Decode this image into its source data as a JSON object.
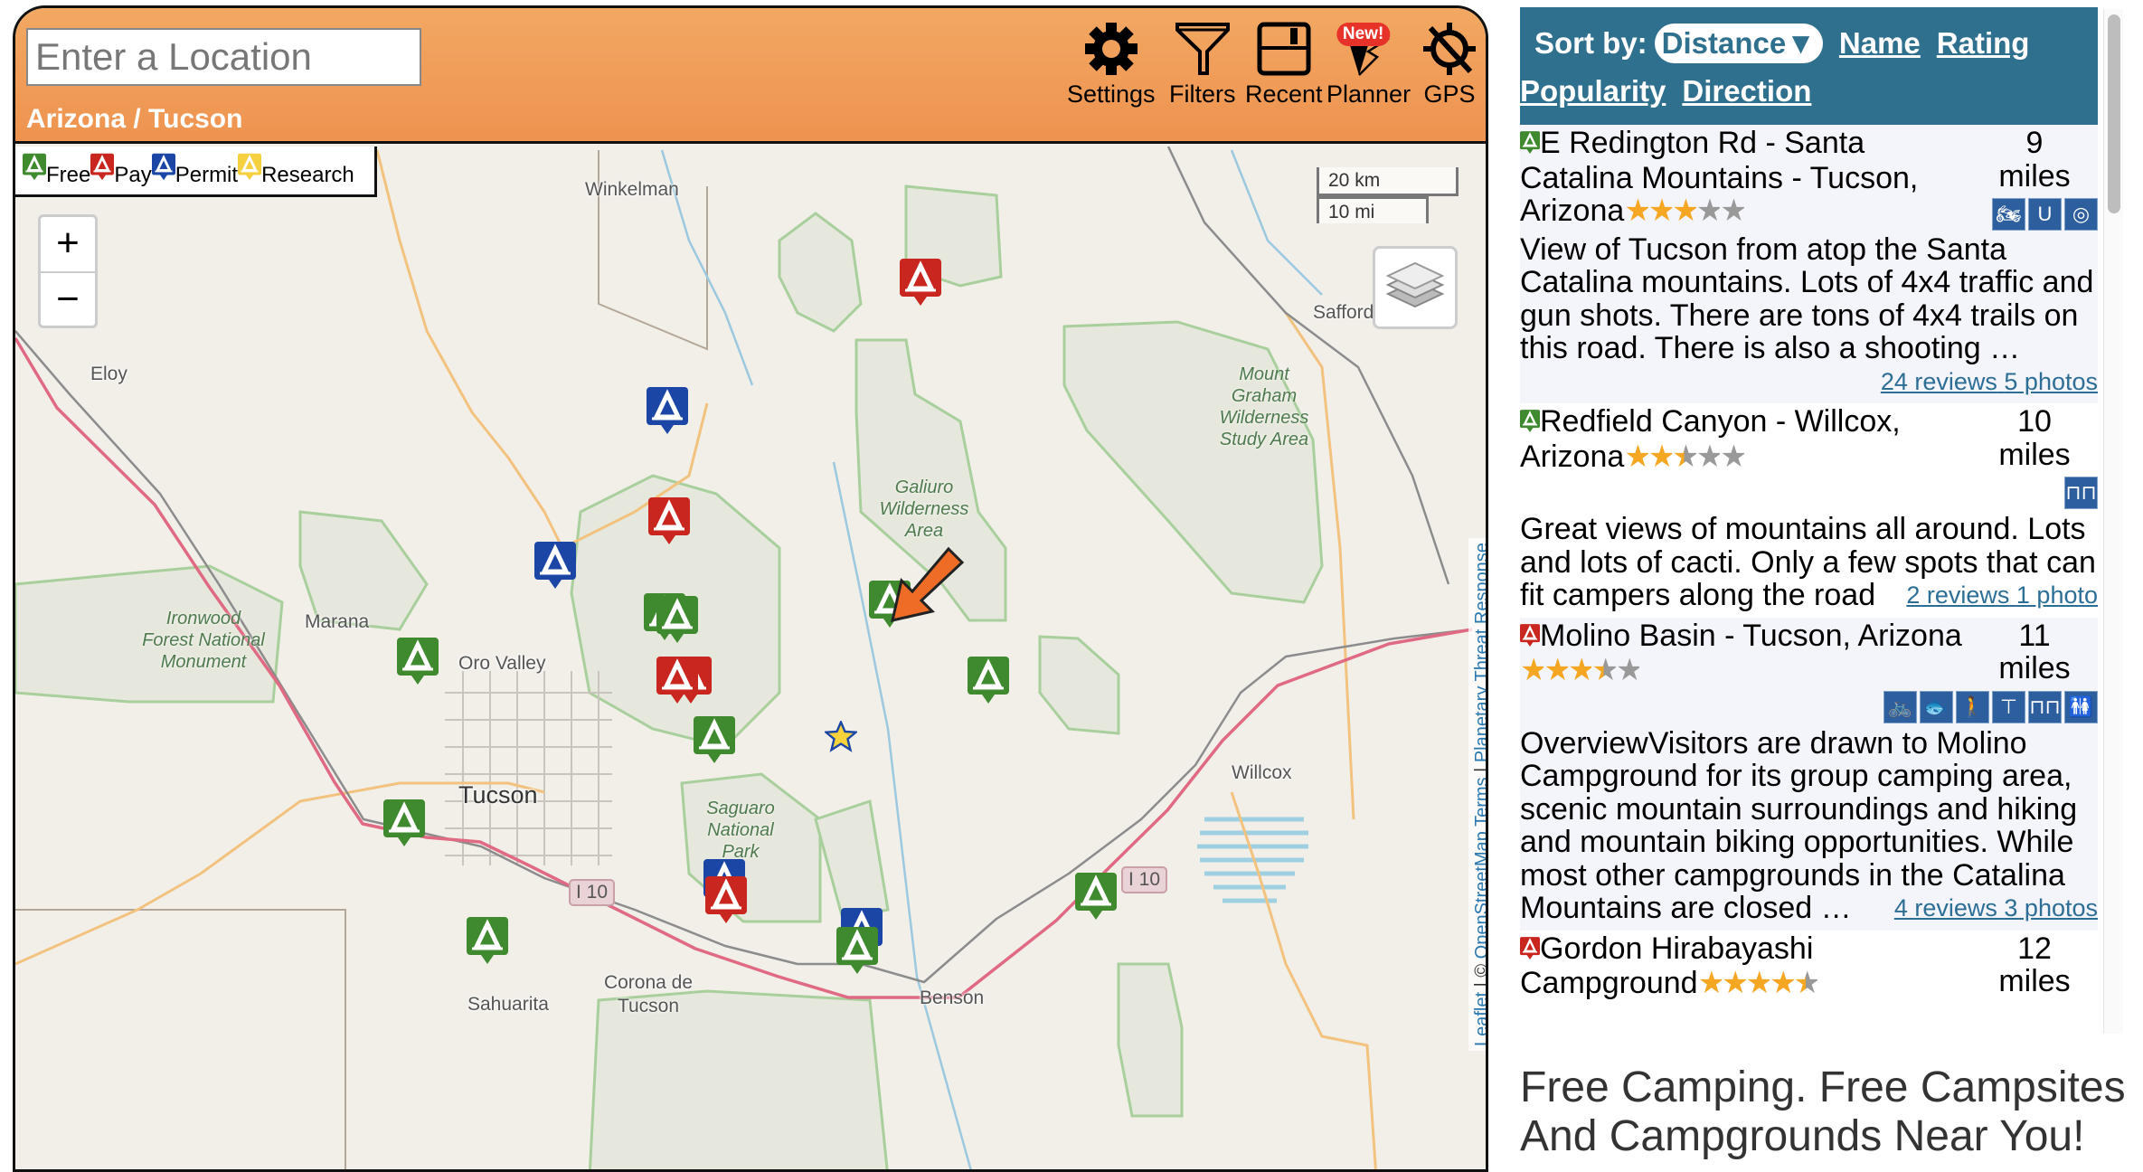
{
  "header": {
    "search_placeholder": "Enter a Location",
    "breadcrumb": "Arizona / Tucson",
    "toolbar": [
      {
        "label": "Settings",
        "icon": "gear-icon"
      },
      {
        "label": "Filters",
        "icon": "funnel-icon"
      },
      {
        "label": "Recent",
        "icon": "floppy-disk-icon"
      },
      {
        "label": "Planner",
        "icon": "map-pin-route-icon",
        "badge": "New!"
      },
      {
        "label": "GPS",
        "icon": "gps-off-icon"
      }
    ]
  },
  "legend": [
    {
      "label": "Free",
      "color": "#3f8a2f"
    },
    {
      "label": "Pay",
      "color": "#c8261e"
    },
    {
      "label": "Permit",
      "color": "#1c46a6"
    },
    {
      "label": "Research",
      "color": "#f5d142"
    }
  ],
  "map": {
    "zoom_in": "+",
    "zoom_out": "−",
    "scale_km": "20 km",
    "scale_mi": "10 mi",
    "attribution": {
      "leaflet": "Leaflet",
      "sep1": " | © ",
      "osm": "OpenStreetMap",
      "terms": " Terms",
      "sep2": " | ",
      "ptr": "Planetary Threat Response"
    },
    "places": [
      "Winkelman",
      "Eloy",
      "Safford",
      "Marana",
      "Oro Valley",
      "Tucson",
      "Willcox",
      "Benson",
      "Sahuarita",
      "Corona de Tucson"
    ],
    "parks": [
      "Mount Graham Wilderness Study Area",
      "Galiuro Wilderness Area",
      "Ironwood Forest National Monument",
      "Saguaro National Park"
    ],
    "highway": "I 10"
  },
  "sort": {
    "label": "Sort by:",
    "active": "Distance▼",
    "options": [
      "Name",
      "Rating",
      "Popularity",
      "Direction"
    ]
  },
  "results": [
    {
      "type": "free",
      "name": "E Redington Rd - Santa Catalina Mountains - Tucson, Arizona",
      "rating": 3,
      "distance": "9",
      "unit": "miles",
      "amenities": [
        "atv-icon",
        "horseshoe-icon",
        "target-icon"
      ],
      "description": "View of Tucson from atop the Santa Catalina mountains. Lots of 4x4 traffic and gun shots. There are tons of 4x4 trails on this road. There is also a shooting …",
      "reviews": "24 reviews",
      "photos": "5 photos"
    },
    {
      "type": "free",
      "name": "Redfield Canyon - Willcox, Arizona",
      "rating": 2.5,
      "distance": "10",
      "unit": "miles",
      "amenities": [
        "binoculars-icon"
      ],
      "description": "Great views of mountains all around. Lots and lots of cacti. Only a few spots that can fit campers along the road",
      "reviews": "2 reviews",
      "photos": "1 photo"
    },
    {
      "type": "pay",
      "name": "Molino Basin - Tucson, Arizona",
      "rating": 3.5,
      "distance": "11",
      "unit": "miles",
      "amenities": [
        "bicycle-icon",
        "fishing-icon",
        "hiking-icon",
        "scenic-viewpoint-icon",
        "binoculars-icon",
        "restrooms-icon"
      ],
      "description": "OverviewVisitors are drawn to Molino Campground for its group camping area, scenic mountain surroundings and hiking and mountain biking opportunities. While most other campgrounds in the Catalina Mountains are closed …",
      "reviews": "4 reviews",
      "photos": "3 photos"
    },
    {
      "type": "pay",
      "name": "Gordon Hirabayashi Campground",
      "rating": 4.5,
      "distance": "12",
      "unit": "miles"
    }
  ],
  "tagline": "Free Camping. Free Campsites And Campgrounds Near You!"
}
